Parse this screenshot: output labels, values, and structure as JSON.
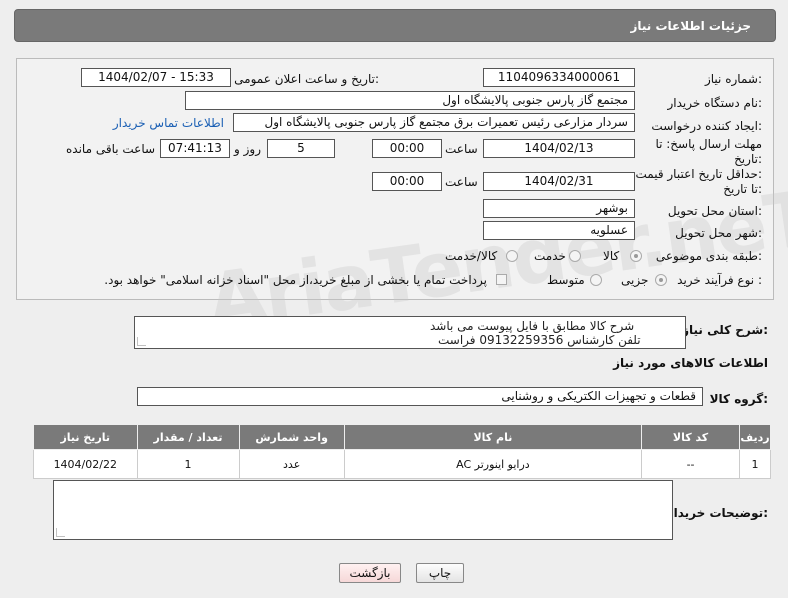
{
  "header": {
    "title": "جزئیات اطلاعات نیاز"
  },
  "watermark": "AriaTender.neT",
  "form": {
    "need_number": {
      "label": "شماره نیاز:",
      "value": "1104096334000061"
    },
    "announce_datetime": {
      "label": "تاریخ و ساعت اعلان عمومی:",
      "value": "1404/02/07 - 15:33"
    },
    "buyer_org": {
      "label": "نام دستگاه خریدار:",
      "value": "مجتمع گاز پارس جنوبی  پالایشگاه اول"
    },
    "requester": {
      "label": "ایجاد کننده درخواست:",
      "value": "سردار مزارعی رئیس تعمیرات برق مجتمع گاز پارس جنوبی  پالایشگاه اول",
      "contact_link": "اطلاعات تماس خریدار"
    },
    "deadline_reply": {
      "label_line1": "مهلت ارسال پاسخ: تا",
      "label_line2": "تاریخ:",
      "date": "1404/02/13",
      "time_label": "ساعت",
      "time": "00:00",
      "days": "5",
      "days_label": "روز و",
      "remaining_time": "07:41:13",
      "remaining_label": "ساعت باقی مانده"
    },
    "price_validity": {
      "label_line1": "حداقل تاریخ اعتبار قیمت:",
      "label_line2": "تا تاریخ:",
      "date": "1404/02/31",
      "time_label": "ساعت",
      "time": "00:00"
    },
    "delivery_province": {
      "label": "استان محل تحویل:",
      "value": "بوشهر"
    },
    "delivery_city": {
      "label": "شهر محل تحویل:",
      "value": "عسلویه"
    },
    "category": {
      "label": "طبقه بندی موضوعی:",
      "options": [
        "کالا",
        "خدمت",
        "کالا/خدمت"
      ],
      "selected": "کالا"
    },
    "purchase_type": {
      "label": "نوع فرآیند خرید :",
      "options": [
        "جزیی",
        "متوسط"
      ],
      "selected": "جزیی",
      "note": "پرداخت تمام یا بخشی از مبلغ خرید،از محل \"اسناد خزانه اسلامی\" خواهد بود."
    },
    "general_desc": {
      "label": "شرح کلی نیاز:",
      "line1": "شرح کالا مطابق با فایل پیوست می باشد",
      "line2": "تلفن کارشناس 09132259356 فراست"
    }
  },
  "goods_section": {
    "title": "اطلاعات کالاهای مورد نیاز",
    "group_label": "گروه کالا:",
    "group_value": "قطعات و تجهیزات الکتریکی و روشنایی",
    "columns": [
      "ردیف",
      "کد کالا",
      "نام کالا",
      "واحد شمارش",
      "تعداد / مقدار",
      "تاریخ نیاز"
    ],
    "rows": [
      {
        "row": "1",
        "code": "--",
        "name": "درایو اینورتر AC",
        "unit": "عدد",
        "qty": "1",
        "date": "1404/02/22"
      }
    ]
  },
  "buyer_notes": {
    "label": "توضیحات خریدار:",
    "value": ""
  },
  "buttons": {
    "print": "چاپ",
    "back": "بازگشت"
  },
  "colors": {
    "header_bg": "#7a7a7a",
    "link": "#1a5fb4",
    "back_button_bg": "#fde8e8"
  }
}
